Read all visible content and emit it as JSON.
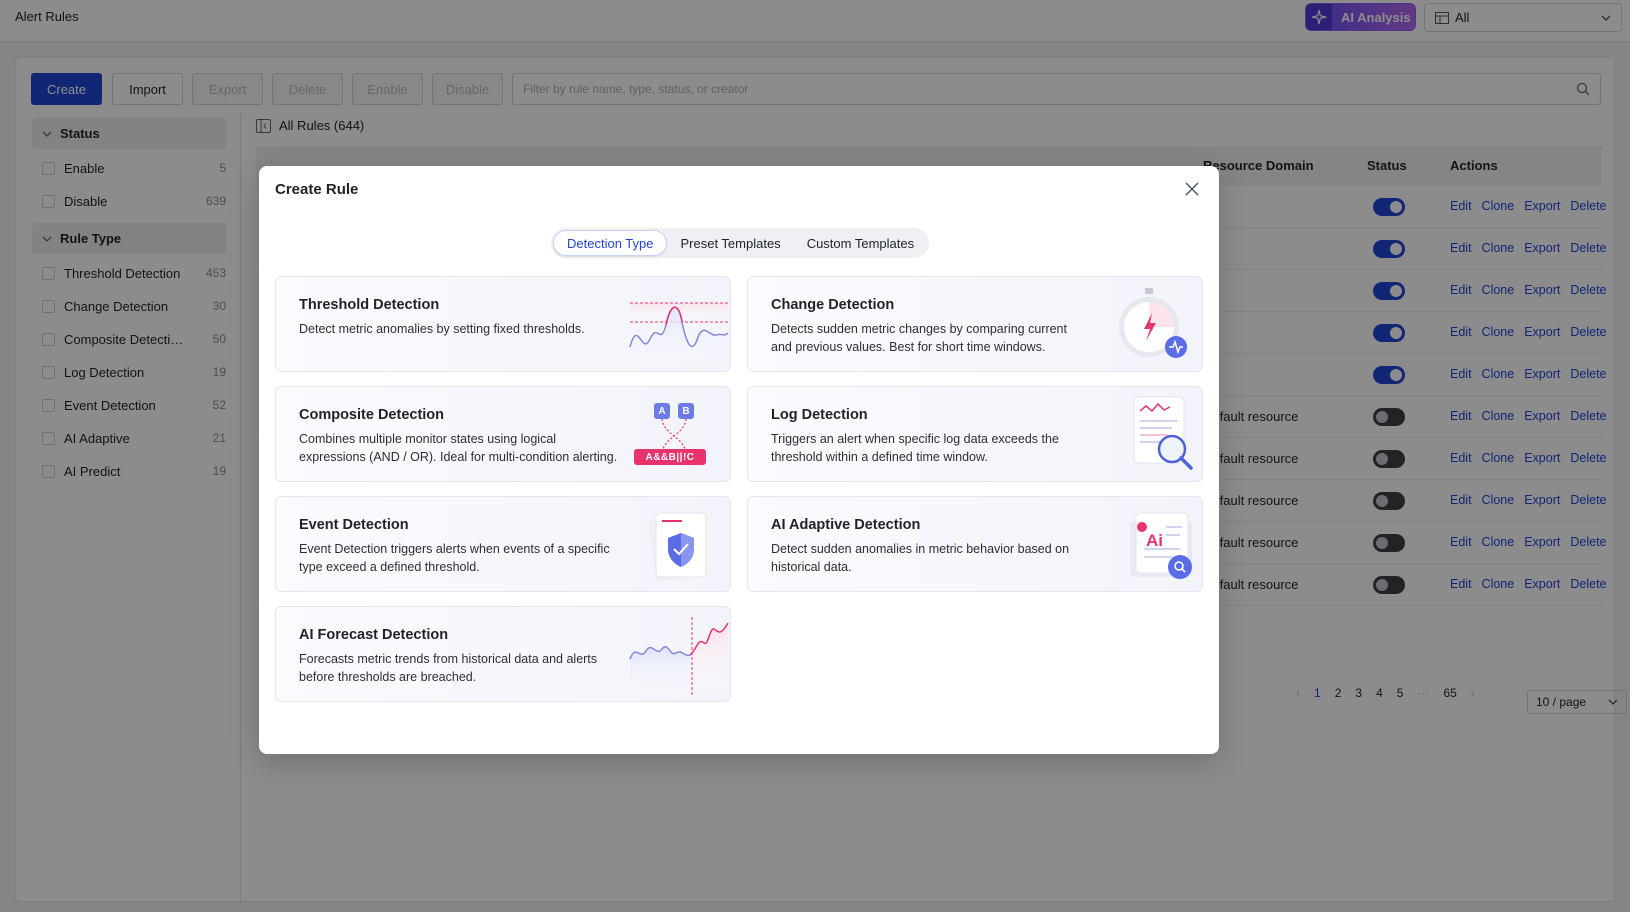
{
  "page": {
    "title": "Alert Rules"
  },
  "header": {
    "ai_analysis_label": "AI Analysis",
    "scope_value": "All"
  },
  "toolbar": {
    "create": "Create",
    "import": "Import",
    "export": "Export",
    "delete": "Delete",
    "enable": "Enable",
    "disable": "Disable",
    "filter_placeholder": "Filter by rule name, type, status, or creator"
  },
  "sidebar": {
    "status_group": "Status",
    "status_items": [
      {
        "label": "Enable",
        "count": "5"
      },
      {
        "label": "Disable",
        "count": "639"
      }
    ],
    "type_group": "Rule Type",
    "type_items": [
      {
        "label": "Threshold Detection",
        "count": "453"
      },
      {
        "label": "Change Detection",
        "count": "30"
      },
      {
        "label": "Composite Detection",
        "count": "50"
      },
      {
        "label": "Log Detection",
        "count": "19"
      },
      {
        "label": "Event Detection",
        "count": "52"
      },
      {
        "label": "AI Adaptive",
        "count": "21"
      },
      {
        "label": "AI Predict",
        "count": "19"
      }
    ]
  },
  "table": {
    "heading": "All Rules (644)",
    "columns": {
      "domain": "Resource Domain",
      "status": "Status",
      "actions": "Actions"
    },
    "rows": [
      {
        "domain": "",
        "enabled": true
      },
      {
        "domain": "",
        "enabled": true
      },
      {
        "domain": "",
        "enabled": true
      },
      {
        "domain": "",
        "enabled": true
      },
      {
        "domain": "",
        "enabled": true
      },
      {
        "domain": "Default resource",
        "enabled": false
      },
      {
        "domain": "Default resource",
        "enabled": false
      },
      {
        "domain": "Default resource",
        "enabled": false
      },
      {
        "domain": "Default resource",
        "enabled": false
      },
      {
        "domain": "Default resource",
        "enabled": false
      }
    ],
    "row_actions": [
      "Edit",
      "Clone",
      "Export",
      "Delete"
    ]
  },
  "pagination": {
    "pages": [
      "1",
      "2",
      "3",
      "4",
      "5",
      "···",
      "65"
    ],
    "current": "1",
    "page_size": "10 / page"
  },
  "modal": {
    "title": "Create Rule",
    "tabs": [
      "Detection Type",
      "Preset Templates",
      "Custom Templates"
    ],
    "active_tab": "Detection Type",
    "cards": [
      {
        "title": "Threshold Detection",
        "desc": "Detect metric anomalies by setting fixed thresholds."
      },
      {
        "title": "Change Detection",
        "desc": "Detects sudden metric changes by comparing current and previous values. Best for short time windows."
      },
      {
        "title": "Composite Detection",
        "desc": "Combines multiple monitor states using logical expressions (AND / OR). Ideal for multi-condition alerting."
      },
      {
        "title": "Log Detection",
        "desc": "Triggers an alert when specific log data exceeds the threshold within a defined time window."
      },
      {
        "title": "Event Detection",
        "desc": "Event Detection triggers alerts when events of a specific type exceed a defined threshold."
      },
      {
        "title": "AI Adaptive Detection",
        "desc": "Detect sudden anomalies in metric behavior based on historical data."
      },
      {
        "title": "AI Forecast Detection",
        "desc": "Forecasts metric trends from historical data and alerts before thresholds are breached."
      }
    ],
    "composite_art": {
      "a": "A",
      "b": "B",
      "expr": "A&&B||!C"
    },
    "ai_art_text": "Ai"
  },
  "colors": {
    "accent": "#1f45d6",
    "alert_pink": "#e8336d",
    "ai_purple": "#6a4cf5"
  }
}
